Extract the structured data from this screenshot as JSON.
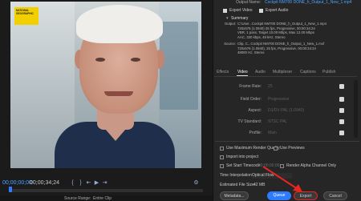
{
  "monitor": {
    "logo_text": "NATIONAL GEOGRAPHIC",
    "timecode_left": "00;00;00;00",
    "timecode_right": "00;00;34;24",
    "source_range_label": "Source Range:",
    "source_range_value": "Entire Clip",
    "controls": [
      "mark-in",
      "mark-out",
      "go-to-in",
      "play",
      "go-to-out",
      "settings"
    ]
  },
  "output": {
    "name_label": "Output Name:",
    "name_value": "Cockpit NM700 DONE_h_Output_1_New_1.mp4",
    "export_video": "Export Video",
    "export_audio": "Export Audio",
    "summary_title": "Summary",
    "output_label": "Output:",
    "output_lines": [
      "C:\\User...Cockpit NM700 DONE_h_Output_1_New_1.mp4",
      "720x576 (1.0940) 25 fps, Progressive, 00:00:34:24",
      "VBR, 1 pass, Target 10.00 Mbps, Max 12.00 Mbps",
      "AAC, 320 kbps, 48 kHz, Stereo"
    ],
    "source_label": "Source:",
    "source_lines": [
      "Clip, C...Cockpit NM700 DONE_h_Output_1_New_1.mxf",
      "720x576 (1.0940), 25 fps, Progressive, 00:00:34:24",
      "48000 Hz, Stereo"
    ]
  },
  "tabs": [
    "Effects",
    "Video",
    "Audio",
    "Multiplexer",
    "Captions",
    "Publish"
  ],
  "active_tab": "Video",
  "video_settings": [
    {
      "label": "Frame Rate:",
      "value": "25"
    },
    {
      "label": "Field Order:",
      "value": "Progressive"
    },
    {
      "label": "Aspect:",
      "value": "D1/DV PAL (1.0940)"
    },
    {
      "label": "TV Standard:",
      "value": "NTSC    PAL"
    },
    {
      "label": "Profile:",
      "value": "Main"
    }
  ],
  "options": {
    "max_render_quality": "Use Maximum Render Quality",
    "use_previews": "Use Previews",
    "import_into_project": "Import into project",
    "set_start_timecode": "Set Start Timecode",
    "start_timecode_value": "00;00;00;00",
    "render_alpha": "Render Alpha Channel Only",
    "time_interp_label": "Time Interpolation:",
    "time_interp_value": "Optical Flow",
    "file_size_label": "Estimated File Size:",
    "file_size_value": "42 MB"
  },
  "buttons": {
    "metadata": "Metadata...",
    "queue": "Queue",
    "export": "Export",
    "cancel": "Cancel"
  },
  "colors": {
    "accent": "#2e7bff",
    "arrow": "#e8261f"
  }
}
